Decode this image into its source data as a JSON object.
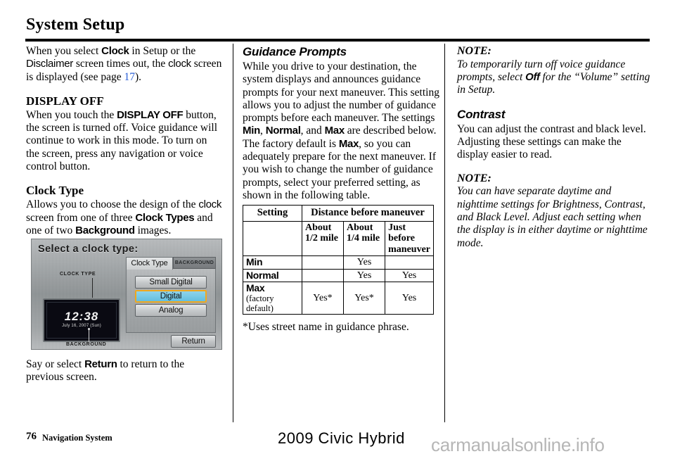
{
  "page": {
    "title": "System Setup",
    "footer_page_number": "76",
    "footer_section": "Navigation System",
    "footer_model": "2009  Civic  Hybrid",
    "watermark": "carmanualsonline.info",
    "link_color": "#2a5fd6"
  },
  "left_column": {
    "intro": {
      "part1": "When you select ",
      "clock_label": "Clock",
      "part2": " in Setup or the ",
      "disclaimer_label": "Disclaimer",
      "part3": " screen times out, the ",
      "clock_word": "clock",
      "part4": " screen is displayed (see page ",
      "page_ref": "17",
      "part5": ")."
    },
    "display_off": {
      "heading": "DISPLAY OFF",
      "part1": "When you touch the ",
      "button_label": "DISPLAY OFF",
      "part2": " button, the screen is turned off. Voice guidance will continue to work in this mode. To turn on the screen, press any navigation or voice control button."
    },
    "clock_type": {
      "heading": "Clock Type",
      "part1": "Allows you to choose the design of the ",
      "clock_word": "clock",
      "part2": " screen from one of three ",
      "clock_types_label": "Clock Types",
      "part3": " and one of two ",
      "background_label": "Background",
      "part4": " images."
    },
    "screenshot": {
      "heading": "Select a clock type:",
      "clock_type_caption": "CLOCK TYPE",
      "background_caption": "BACKGROUND",
      "clock_time": "12:38",
      "clock_date": "July 16, 2007 (Sun)",
      "tab_clock_type": "Clock Type",
      "tab_background": "BACKGROUND",
      "option_small_digital": "Small Digital",
      "option_digital": "Digital",
      "option_analog": "Analog",
      "return_button": "Return",
      "selected_option": "Digital",
      "highlight_fill": "#63bfdf",
      "highlight_border": "#f0a81e"
    },
    "caption": {
      "part1": "Say or select ",
      "return_label": "Return",
      "part2": " to return to the previous screen."
    }
  },
  "middle_column": {
    "guidance_prompts": {
      "heading": "Guidance Prompts",
      "part1": "While you drive to your destination, the system displays and announces guidance prompts for your next maneuver. This setting allows you to adjust the number of guidance prompts before each maneuver. The settings ",
      "min_label": "Min",
      "sep1": ", ",
      "normal_label": "Normal",
      "sep2": ", and ",
      "max_label": "Max",
      "part2": " are described below. The factory default is ",
      "max_label2": "Max",
      "part3": ", so you can adequately prepare for the next maneuver. If you wish to change the number of guidance prompts, select your preferred setting, as shown in the following table."
    },
    "footnote": "*Uses street name in guidance phrase."
  },
  "chart_data": {
    "type": "table",
    "title": "",
    "header_setting": "Setting",
    "header_distance": "Distance before maneuver",
    "sub_headers": [
      "",
      "About 1/2 mile",
      "About 1/4 mile",
      "Just before maneuver"
    ],
    "rows": [
      {
        "setting": "Min",
        "setting_note": "",
        "values": [
          "",
          "Yes",
          ""
        ]
      },
      {
        "setting": "Normal",
        "setting_note": "",
        "values": [
          "",
          "Yes",
          "Yes"
        ]
      },
      {
        "setting": "Max",
        "setting_note": "(factory default)",
        "values": [
          "Yes*",
          "Yes*",
          "Yes"
        ]
      }
    ]
  },
  "right_column": {
    "note1": {
      "heading": "NOTE:",
      "part1": "To temporarily turn off voice guidance prompts, select ",
      "off_label": "Off",
      "part2": " for the “Volume” setting in Setup."
    },
    "contrast": {
      "heading": "Contrast",
      "body": "You can adjust the contrast and black level. Adjusting these settings can make the display easier to read."
    },
    "note2": {
      "heading": "NOTE:",
      "body": "You can have separate daytime and nighttime settings for Brightness, Contrast, and Black Level. Adjust each setting when the display is in either daytime or nighttime mode."
    }
  }
}
